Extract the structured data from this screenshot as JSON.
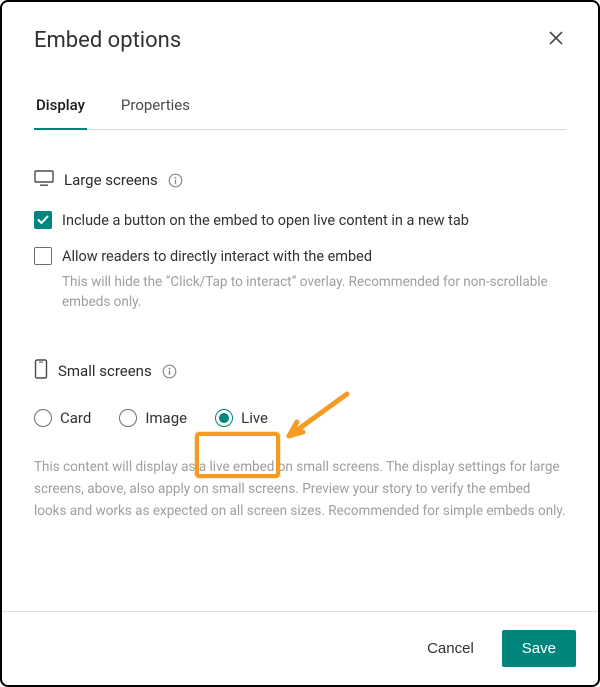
{
  "header": {
    "title": "Embed options"
  },
  "tabs": {
    "display": "Display",
    "properties": "Properties"
  },
  "large_screens": {
    "label": "Large screens",
    "option_new_tab": "Include a button on the embed to open live content in a new tab",
    "option_interact": "Allow readers to directly interact with the embed",
    "interact_help": "This will hide the “Click/Tap to interact” overlay. Recommended for non-scrollable embeds only."
  },
  "small_screens": {
    "label": "Small screens",
    "options": {
      "card": "Card",
      "image": "Image",
      "live": "Live"
    },
    "desc": "This content will display as a live embed on small screens. The display settings for large screens, above, also apply on small screens. Preview your story to verify the embed looks and works as expected on all screen sizes. Recommended for simple embeds only."
  },
  "footer": {
    "cancel": "Cancel",
    "save": "Save"
  },
  "annotation": {
    "highlight_color": "#f59b23"
  }
}
